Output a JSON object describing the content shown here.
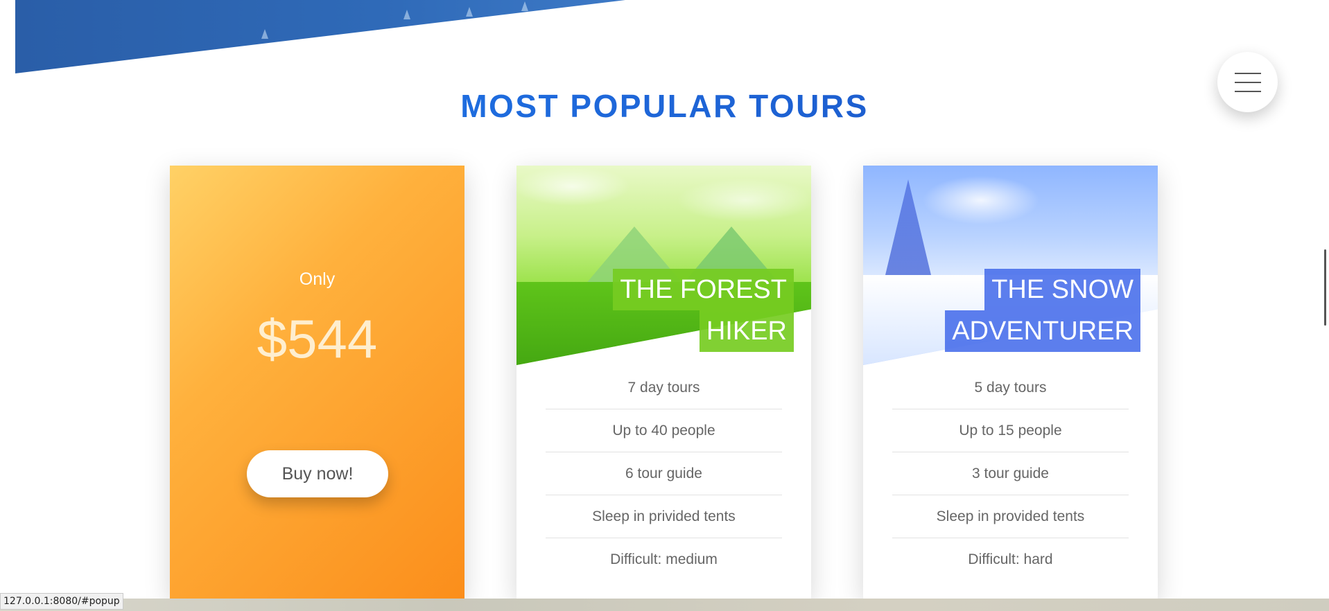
{
  "section": {
    "title": "MOST POPULAR TOURS"
  },
  "menu": {
    "icon": "hamburger-menu-icon"
  },
  "price_card": {
    "only_label": "Only",
    "price": "$544",
    "button_label": "Buy now!",
    "accent_color": "#fb8e1b"
  },
  "tours": [
    {
      "heading_line1": "THE FOREST",
      "heading_line2": "HIKER",
      "accent_color": "#76cc22",
      "details": [
        "7 day tours",
        "Up to 40 people",
        "6 tour guide",
        "Sleep in privided tents",
        "Difficult: medium"
      ]
    },
    {
      "heading_line1": "THE SNOW",
      "heading_line2": "ADVENTURER",
      "accent_color": "#4a70eb",
      "details": [
        "5 day tours",
        "Up to 15 people",
        "3 tour guide",
        "Sleep in provided tents",
        "Difficult: hard"
      ]
    }
  ],
  "status": {
    "url": "127.0.0.1:8080/#popup"
  }
}
